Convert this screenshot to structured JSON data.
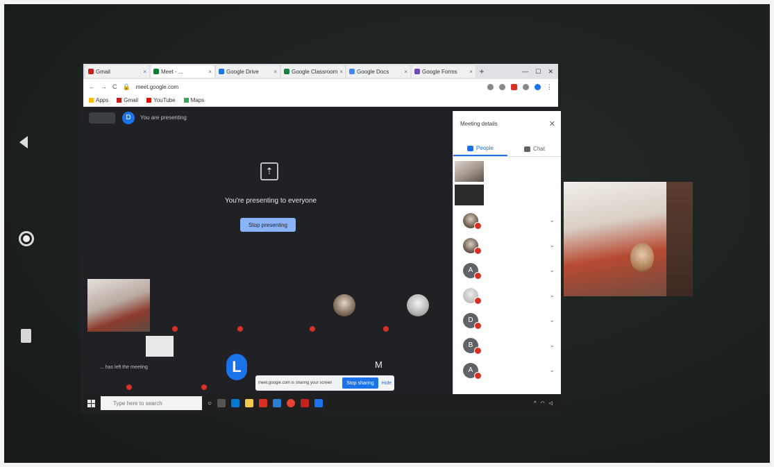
{
  "browser": {
    "tabs": [
      {
        "label": "Gmail",
        "active": false
      },
      {
        "label": "Meet - ...",
        "active": true
      },
      {
        "label": "Google Drive",
        "active": false
      },
      {
        "label": "Google Classroom",
        "active": false
      },
      {
        "label": "Google Docs",
        "active": false
      },
      {
        "label": "Google Forms",
        "active": false
      }
    ],
    "url": "meet.google.com",
    "bookmarks": [
      "Apps",
      "Gmail",
      "YouTube",
      "Maps"
    ]
  },
  "meet": {
    "meeting_code": "",
    "presenter_initial": "D",
    "presenting_label": "You are presenting",
    "presenting_message": "You're presenting to everyone",
    "stop_presenting_label": "Stop presenting",
    "left_meeting_message": "... has left the meeting",
    "big_avatar_initial": "L",
    "m_initial": "M",
    "share_banner_text": "meet.google.com is sharing your screen",
    "share_banner_stop": "Stop sharing",
    "share_banner_hide": "Hide"
  },
  "panel": {
    "title": "Meeting details",
    "tab_people": "People",
    "tab_chat": "Chat",
    "participants": [
      {
        "initial": "",
        "name": "",
        "kind": "thumb"
      },
      {
        "initial": "",
        "name": "",
        "kind": "thumb"
      },
      {
        "initial": "",
        "name": "",
        "kind": "photo"
      },
      {
        "initial": "",
        "name": "",
        "kind": "photo"
      },
      {
        "initial": "A",
        "name": "",
        "kind": "letter"
      },
      {
        "initial": "",
        "name": "",
        "kind": "light"
      },
      {
        "initial": "D",
        "name": "",
        "kind": "letter"
      },
      {
        "initial": "B",
        "name": "",
        "kind": "letter"
      },
      {
        "initial": "A",
        "name": "",
        "kind": "letter"
      }
    ]
  },
  "taskbar": {
    "search_placeholder": "Type here to search",
    "time": ""
  },
  "colors": {
    "meet_bg": "#202124",
    "accent": "#1a73e8",
    "muted_red": "#d93025",
    "photo_bg": "#1d2320"
  }
}
